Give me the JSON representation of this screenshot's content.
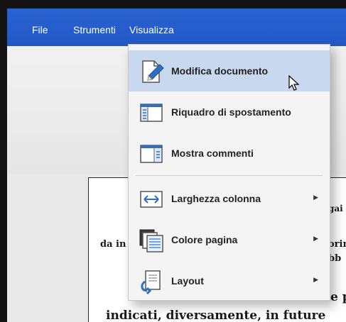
{
  "menubar": {
    "items": [
      {
        "label": "File"
      },
      {
        "label": "Strumenti"
      },
      {
        "label": "Visualizza"
      }
    ]
  },
  "view_menu": {
    "items": [
      {
        "label": "Modifica documento",
        "icon": "edit-document-icon",
        "highlighted": true,
        "has_submenu": false
      },
      {
        "label": "Riquadro di spostamento",
        "icon": "navigation-pane-icon",
        "highlighted": false,
        "has_submenu": false
      },
      {
        "label": "Mostra commenti",
        "icon": "show-comments-icon",
        "highlighted": false,
        "has_submenu": false
      },
      {
        "label": "Larghezza colonna",
        "icon": "column-width-icon",
        "highlighted": false,
        "has_submenu": true
      },
      {
        "label": "Colore pagina",
        "icon": "page-color-icon",
        "highlighted": false,
        "has_submenu": true
      },
      {
        "label": "Layout",
        "icon": "layout-icon",
        "highlighted": false,
        "has_submenu": true
      }
    ]
  },
  "document": {
    "visible_text": [
      "gai",
      "da in",
      "orin",
      "bb",
      "e p",
      "indicati, diversamente, in future"
    ]
  },
  "colors": {
    "menubar": "#2158c8",
    "menu_background": "#f4f4f4",
    "highlight": "#c8d8ef",
    "icon_blue": "#2f6fc0"
  }
}
